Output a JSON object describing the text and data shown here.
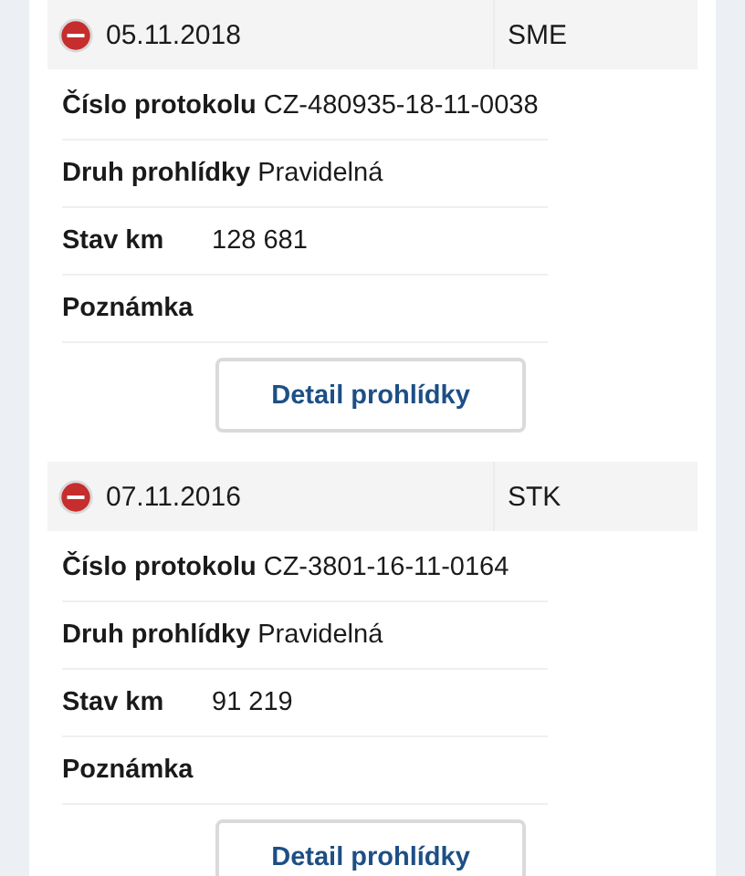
{
  "inspections": [
    {
      "date": "05.11.2018",
      "type": "SME",
      "expanded": true,
      "fields": [
        {
          "label": "Číslo protokolu",
          "value": "CZ-480935-18-11-0038"
        },
        {
          "label": "Druh prohlídky",
          "value": "Pravidelná"
        },
        {
          "label": "Stav km",
          "value": "128 681"
        },
        {
          "label": "Poznámka"
        }
      ],
      "button": "Detail prohlídky"
    },
    {
      "date": "07.11.2016",
      "type": "STK",
      "expanded": true,
      "fields": [
        {
          "label": "Číslo protokolu",
          "value": "CZ-3801-16-11-0164"
        },
        {
          "label": "Druh prohlídky",
          "value": "Pravidelná"
        },
        {
          "label": "Stav km",
          "value": "91 219"
        },
        {
          "label": "Poznámka"
        }
      ],
      "button": "Detail prohlídky"
    }
  ]
}
